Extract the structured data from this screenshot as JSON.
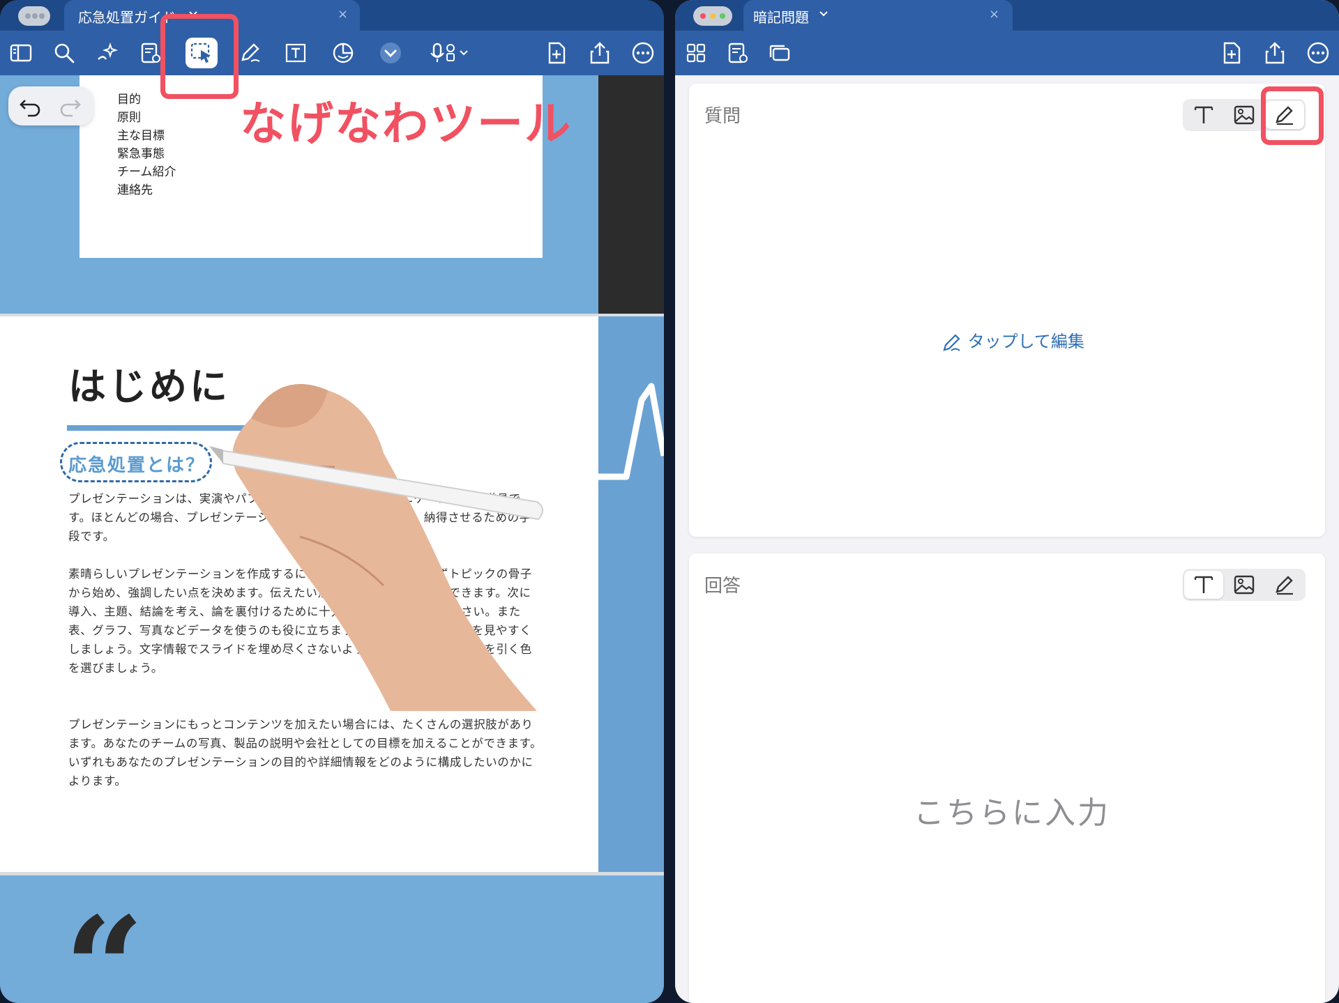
{
  "left_window": {
    "tab_title": "応急処置ガイド",
    "tab_close": "×",
    "annotation": "なげなわツール"
  },
  "right_window": {
    "tab_title": "暗記問題",
    "tab_close": "×"
  },
  "toc": [
    "目的",
    "原則",
    "主な目標",
    "緊急事態",
    "チーム紹介",
    "連絡先"
  ],
  "doc": {
    "heading": "はじめに",
    "subheading": "応急処置とは？",
    "paragraphs": [
      "プレゼンテーションは、実演やパフォーマンスと同じくコミュニケーションの道具です。ほとんどの場合、プレゼンテーションには様々な目的があり、納得させるための手段です。",
      "素晴らしいプレゼンテーションを作成するには、準備が大事です。まずトピックの骨子から始め、強調したい点を決めます。伝えたい点はどのテーマにも適用できます。次に導入、主題、結論を考え、論を裏付けるために十分な調査を必ずしてください。また表、グラフ、写真などデータを使うのも役に立ちます。プレゼンテーションを見やすくしましょう。文字情報でスライドを埋め尽くさないように気をつけ、聴衆の目を引く色を選びましょう。",
      "プレゼンテーションにもっとコンテンツを加えたい場合には、たくさんの選択肢があります。あなたのチームの写真、製品の説明や会社としての目標を加えることができます。いずれもあなたのプレゼンテーションの目的や詳細情報をどのように構成したいのかによります。"
    ],
    "quote_mark": "“"
  },
  "question_card": {
    "label": "質問",
    "tap_to_edit": "タップして編集"
  },
  "answer_card": {
    "label": "回答",
    "placeholder": "こちらに入力"
  },
  "colors": {
    "toolbar": "#2f5fa6",
    "tabbar": "#1f4a8a",
    "highlight": "#f15161",
    "doc_blue": "#73abd9"
  },
  "icons": {
    "left_toolbar": [
      "sidebar-icon",
      "search-icon",
      "magic-icon",
      "note-view-icon",
      "lasso-icon",
      "pen-icon",
      "textbox-icon",
      "sticker-icon",
      "chevron-down-icon",
      "mic-icon",
      "add-page-icon",
      "share-icon",
      "more-icon"
    ],
    "right_toolbar": [
      "grid-icon",
      "flashcard-icon",
      "cards-icon",
      "add-page-icon",
      "share-icon",
      "more-icon"
    ]
  }
}
